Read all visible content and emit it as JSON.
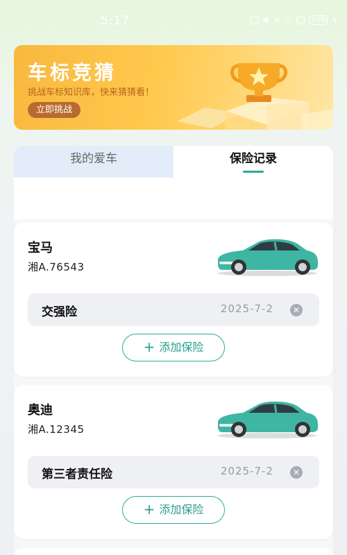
{
  "status_bar": {
    "time": "5:17",
    "battery": "100"
  },
  "banner": {
    "title": "车标竞猜",
    "subtitle": "挑战车标知识库，快来猜猜看！",
    "button_label": "立即挑战",
    "colors": {
      "gradient_start": "#f9b840",
      "button": "#b96a2d"
    }
  },
  "tabs": [
    {
      "label": "我的爱车",
      "active": false
    },
    {
      "label": "保险记录",
      "active": true
    }
  ],
  "accent_color": "#2aaa99",
  "cars": [
    {
      "brand": "宝马",
      "plate": "湘A.76543",
      "car_icon": "teal-car-image",
      "insurance": {
        "name": "交强险",
        "date": "2025-7-2"
      },
      "add_label": "添加保险"
    },
    {
      "brand": "奥迪",
      "plate": "湘A.12345",
      "car_icon": "teal-car-image",
      "insurance": {
        "name": "第三者责任险",
        "date": "2025-7-2"
      },
      "add_label": "添加保险"
    }
  ]
}
